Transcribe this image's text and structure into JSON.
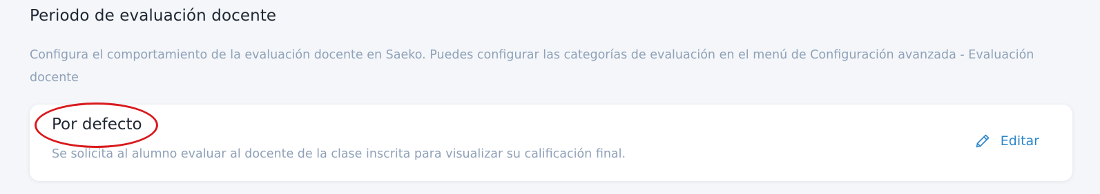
{
  "section": {
    "title": "Periodo de evaluación docente",
    "description": "Configura el comportamiento de la evaluación docente en Saeko. Puedes configurar las categorías de evaluación en el menú de Configuración avanzada - Evaluación docente"
  },
  "card": {
    "title": "Por defecto",
    "description": "Se solicita al alumno evaluar al docente de la clase inscrita para visualizar su calificación final.",
    "edit_label": "Editar",
    "edit_icon": "pencil-icon"
  },
  "colors": {
    "accent": "#2a86c9",
    "annotation": "#d9191c",
    "muted_text": "#8fa1b8"
  }
}
